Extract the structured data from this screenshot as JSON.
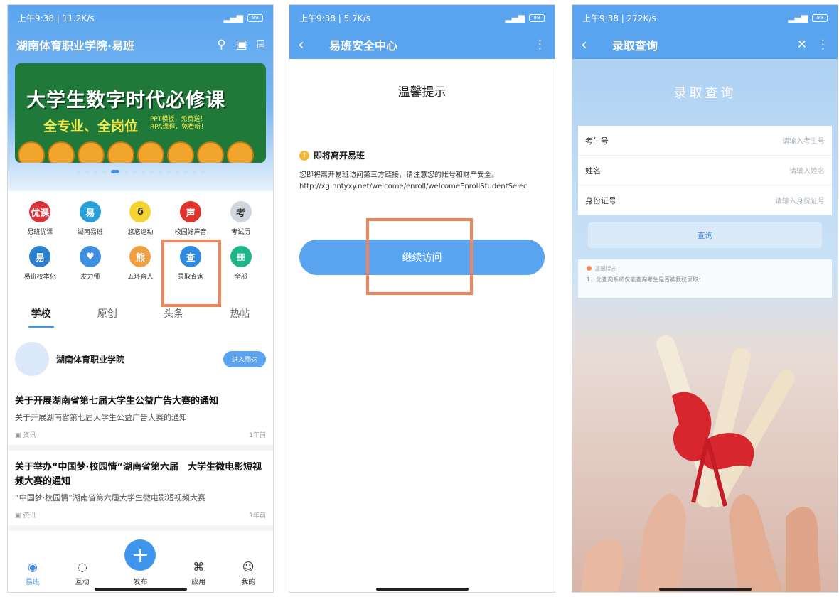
{
  "colors": {
    "primary": "#5aa4ef",
    "highlight": "#f0845a"
  },
  "screen1": {
    "status": {
      "time": "上午9:38 | 11.2K/s",
      "battery": "99"
    },
    "nav_title": "湖南体育职业学院·易班",
    "banner": {
      "headline": "大学生数字时代必修课",
      "sub": "全专业、全岗位",
      "promo_line1": "PPT模板，免费送！",
      "promo_line2": "RPA课程，免费听！"
    },
    "apps": [
      {
        "label": "易班优课",
        "icon": "youke-icon",
        "text": "优课",
        "color": "#d8343a"
      },
      {
        "label": "湖南易班",
        "icon": "hunan-yiban-icon",
        "text": "易",
        "color": "#29a0d8"
      },
      {
        "label": "悠悠运动",
        "icon": "sports-icon",
        "text": "δ",
        "color": "#f5d330"
      },
      {
        "label": "校园好声音",
        "icon": "voice-icon",
        "text": "声",
        "color": "#e1332c"
      },
      {
        "label": "考试历",
        "icon": "calendar-icon",
        "text": "考",
        "color": "#cfd6dd"
      },
      {
        "label": "易班校本化",
        "icon": "campus-icon",
        "text": "易",
        "color": "#2a7fd0"
      },
      {
        "label": "发力师",
        "icon": "heart-icon",
        "text": "♥",
        "color": "#3f8fe0"
      },
      {
        "label": "五环育人",
        "icon": "bear-icon",
        "text": "熊",
        "color": "#f0a040"
      },
      {
        "label": "录取查询",
        "icon": "admission-query-icon",
        "text": "查",
        "color": "#2e8be0"
      },
      {
        "label": "全部",
        "icon": "all-apps-icon",
        "text": "▦",
        "color": "#1fb58a"
      }
    ],
    "tabs": [
      "学校",
      "原创",
      "头条",
      "热帖"
    ],
    "school_name": "湖南体育职业学院",
    "enter_label": "进入圈达",
    "news": [
      {
        "title": "关于开展湖南省第七届大学生公益广告大赛的通知",
        "sub": "关于开展湖南省第七届大学生公益广告大赛的通知",
        "tag": "资讯",
        "time": "1年前"
      },
      {
        "title": "关于举办“中国梦·校园情”湖南省第六届　大学生微电影短视频大赛的通知",
        "sub": "“中国梦·校园情”湖南省第六届大学生微电影短视频大赛",
        "tag": "资讯",
        "time": "1年前"
      }
    ],
    "bottom_nav": [
      "易班",
      "互动",
      "发布",
      "应用",
      "我的"
    ]
  },
  "screen2": {
    "status": {
      "time": "上午9:38 | 5.7K/s",
      "battery": "99"
    },
    "nav_title": "易班安全中心",
    "heading": "温馨提示",
    "warn_title": "即将离开易班",
    "warn_desc": "您即将离开易班访问第三方链接，请注意您的账号和财产安全。",
    "url": "http://xg.hntyxy.net/welcome/enroll/welcomeEnrollStudentSelec",
    "continue_label": "继续访问"
  },
  "screen3": {
    "status": {
      "time": "上午9:38 | 272K/s",
      "battery": "99"
    },
    "nav_title": "录取查询",
    "heading": "录取查询",
    "fields": [
      {
        "label": "考生号",
        "placeholder": "请输入考生号"
      },
      {
        "label": "姓名",
        "placeholder": "请输入姓名"
      },
      {
        "label": "身份证号",
        "placeholder": "请输入身份证号"
      }
    ],
    "query_label": "查询",
    "tip_title": "温馨提示",
    "tip_text": "1、此查询系统仅能查询考生是否被我校录取："
  }
}
